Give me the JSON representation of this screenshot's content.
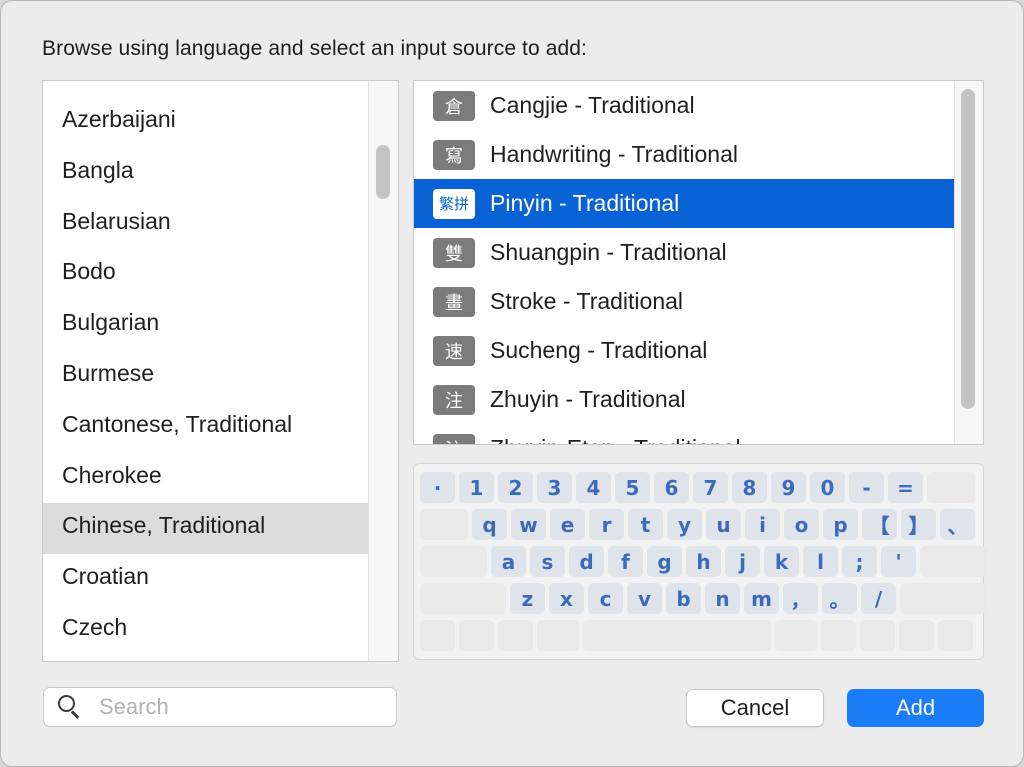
{
  "dialog": {
    "prompt": "Browse using language and select an input source to add:"
  },
  "languages": {
    "items": [
      {
        "label": "Azerbaijani"
      },
      {
        "label": "Bangla"
      },
      {
        "label": "Belarusian"
      },
      {
        "label": "Bodo"
      },
      {
        "label": "Bulgarian"
      },
      {
        "label": "Burmese"
      },
      {
        "label": "Cantonese, Traditional"
      },
      {
        "label": "Cherokee"
      },
      {
        "label": "Chinese, Traditional",
        "selected": true
      },
      {
        "label": "Croatian"
      },
      {
        "label": "Czech"
      }
    ]
  },
  "input_sources": {
    "items": [
      {
        "icon": "倉",
        "label": "Cangjie - Traditional"
      },
      {
        "icon": "寫",
        "label": "Handwriting - Traditional"
      },
      {
        "icon": "繁拼",
        "label": "Pinyin - Traditional",
        "selected": true
      },
      {
        "icon": "雙",
        "label": "Shuangpin - Traditional"
      },
      {
        "icon": "畫",
        "label": "Stroke - Traditional"
      },
      {
        "icon": "速",
        "label": "Sucheng - Traditional"
      },
      {
        "icon": "注",
        "label": "Zhuyin - Traditional"
      },
      {
        "icon": "注",
        "label": "Zhuyin-Eten - Traditional"
      }
    ]
  },
  "keyboard": {
    "rows": [
      [
        "·",
        "1",
        "2",
        "3",
        "4",
        "5",
        "6",
        "7",
        "8",
        "9",
        "0",
        "-",
        "="
      ],
      [
        "q",
        "w",
        "e",
        "r",
        "t",
        "y",
        "u",
        "i",
        "o",
        "p",
        "【",
        "】",
        "、"
      ],
      [
        "a",
        "s",
        "d",
        "f",
        "g",
        "h",
        "j",
        "k",
        "l",
        ";",
        "'"
      ],
      [
        "z",
        "x",
        "c",
        "v",
        "b",
        "n",
        "m",
        "，",
        "。",
        "/"
      ]
    ]
  },
  "search": {
    "placeholder": "Search",
    "value": ""
  },
  "buttons": {
    "cancel": "Cancel",
    "add": "Add"
  },
  "colors": {
    "accent": "#1a7cf6",
    "selection": "#0a63d6",
    "key_text": "#3d6bbb"
  }
}
